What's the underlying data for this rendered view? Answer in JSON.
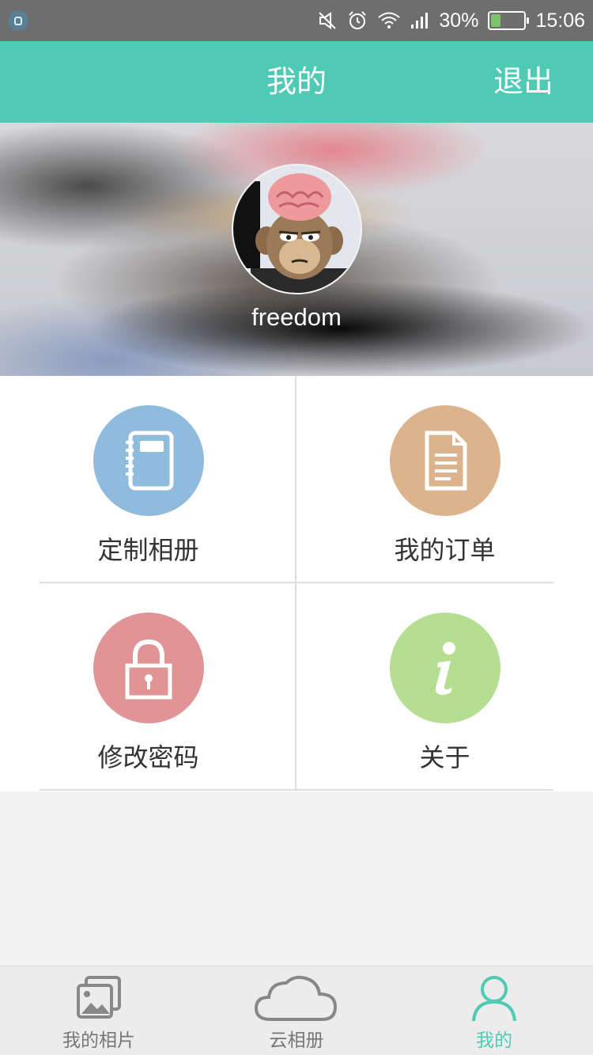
{
  "status_bar": {
    "battery": "30%",
    "time": "15:06",
    "battery_level": 0.3
  },
  "header": {
    "title": "我的",
    "logout": "退出"
  },
  "profile": {
    "username": "freedom"
  },
  "menu": [
    {
      "label": "定制相册",
      "icon": "notebook-icon",
      "color": "#8fbbdc"
    },
    {
      "label": "我的订单",
      "icon": "document-icon",
      "color": "#dbb48d"
    },
    {
      "label": "修改密码",
      "icon": "lock-icon",
      "color": "#e09496"
    },
    {
      "label": "关于",
      "icon": "info-icon",
      "color": "#b5de90"
    }
  ],
  "tabs": [
    {
      "label": "我的相片",
      "icon": "photos-icon"
    },
    {
      "label": "云相册",
      "icon": "cloud-icon"
    },
    {
      "label": "我的",
      "icon": "user-icon",
      "active": true
    }
  ],
  "colors": {
    "accent": "#4ecab5",
    "status_bar": "#6e6e6e"
  }
}
